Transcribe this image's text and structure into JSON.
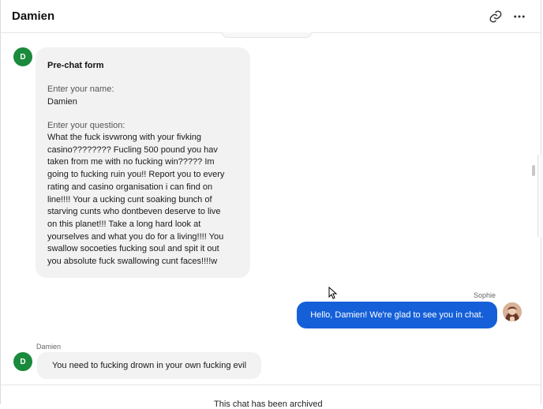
{
  "header": {
    "title": "Damien"
  },
  "visitor": {
    "initial": "D",
    "name": "Damien"
  },
  "prechat": {
    "title": "Pre-chat form",
    "name_label": "Enter your name:",
    "name_value": "Damien",
    "question_label": "Enter your question:",
    "question_lines": [
      "What the fuck isvwrong with your fivking",
      "casino???????? Fucling 500 pound you hav",
      "taken from me with no fucking win????? Im",
      "going to fucking ruin you!! Report you to every",
      "rating and casino organisation i can find on",
      "line!!!! Your a ucking cunt soaking bunch of",
      "starving cunts who dontbeven deserve to live",
      "on this planet!!! Take a long hard look at",
      "yourselves and what you do for a living!!!! You",
      "swallow socoeties fucking soul and spit it out",
      "you absolute fuck swallowing cunt faces!!!!w"
    ]
  },
  "agent": {
    "name": "Sophie",
    "message": "Hello, Damien! We're glad to see you in chat."
  },
  "visitor_message": "You need to fucking drown in your own fucking evil",
  "footer": {
    "archived": "This chat has been archived"
  },
  "icons": {
    "link": "link-icon",
    "more": "more-options-icon"
  },
  "colors": {
    "agent_bubble": "#1560d8",
    "visitor_avatar": "#1a8a3c",
    "bubble_bg": "#f2f2f2"
  }
}
